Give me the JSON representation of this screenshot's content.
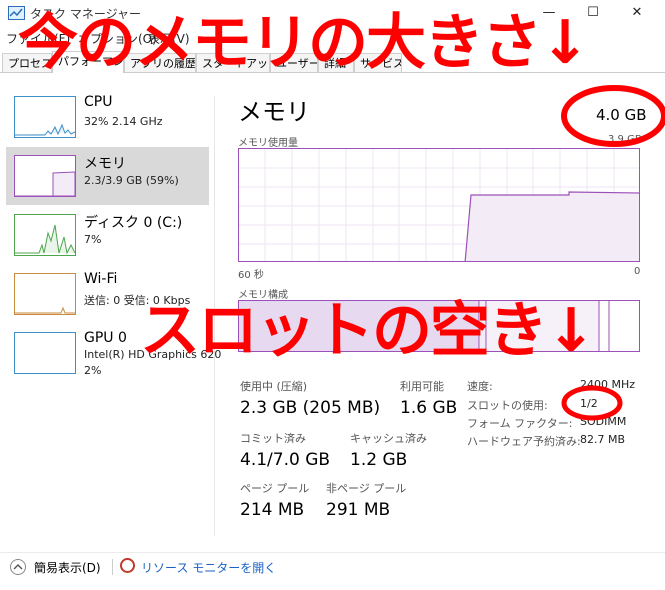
{
  "window": {
    "title": "タスク マネージャー",
    "controls": [
      "—",
      "☐",
      "✕"
    ]
  },
  "menu": [
    "ファイル(F)",
    "オプション(O)",
    "表示(V)"
  ],
  "tabs": [
    "プロセス",
    "パフォーマンス",
    "アプリの履歴",
    "スタートアップ",
    "ユーザー",
    "詳細",
    "サービス"
  ],
  "sidebar": [
    {
      "name": "CPU",
      "sub": "32%  2.14 GHz",
      "sub2": ""
    },
    {
      "name": "メモリ",
      "sub": "2.3/3.9 GB (59%)",
      "sub2": ""
    },
    {
      "name": "ディスク 0 (C:)",
      "sub": "7%",
      "sub2": ""
    },
    {
      "name": "Wi-Fi",
      "sub": "送信: 0  受信: 0 Kbps",
      "sub2": ""
    },
    {
      "name": "GPU 0",
      "sub": "Intel(R) HD Graphics 620",
      "sub2": "2%"
    }
  ],
  "main": {
    "title": "メモリ",
    "total": "4.0 GB",
    "usage_label": "メモリ使用量",
    "usage_max": "3.9 GB",
    "time_left": "60 秒",
    "time_right": "0",
    "composition_label": "メモリ構成",
    "stats": {
      "in_use_label": "使用中 (圧縮)",
      "in_use": "2.3 GB (205 MB)",
      "available_label": "利用可能",
      "available": "1.6 GB",
      "committed_label": "コミット済み",
      "committed": "4.1/7.0 GB",
      "cached_label": "キャッシュ済み",
      "cached": "1.2 GB",
      "paged_label": "ページ プール",
      "paged": "214 MB",
      "nonpaged_label": "非ページ プール",
      "nonpaged": "291 MB"
    },
    "details": [
      {
        "label": "速度:",
        "value": "2400 MHz"
      },
      {
        "label": "スロットの使用:",
        "value": "1/2"
      },
      {
        "label": "フォーム ファクター:",
        "value": "SODIMM"
      },
      {
        "label": "ハードウェア予約済み:",
        "value": "82.7 MB"
      }
    ]
  },
  "footer": {
    "fewer_details": "簡易表示(D)",
    "resource_monitor": "リソース モニターを開く"
  },
  "annotations": {
    "top": "今のメモリの大きさ↓",
    "middle": "スロットの空き↓",
    "color": "#ff0000"
  }
}
